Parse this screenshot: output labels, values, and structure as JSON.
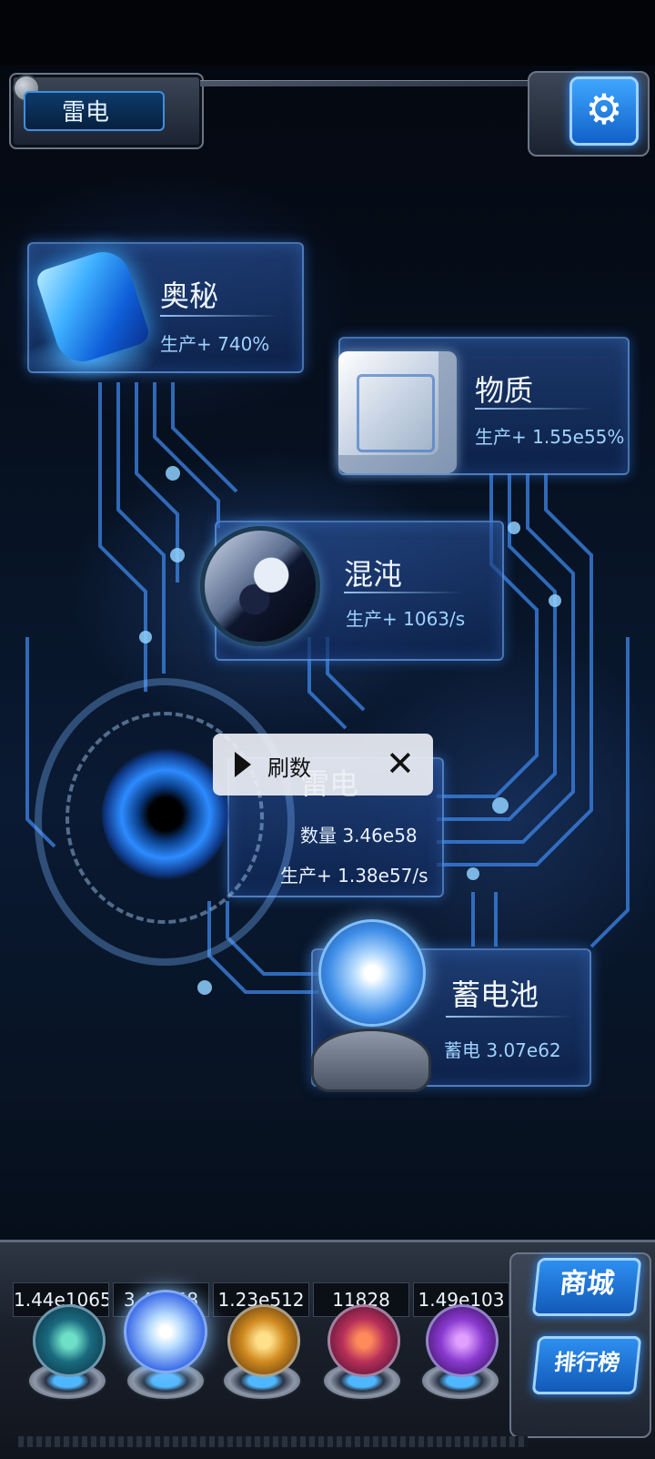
{
  "header": {
    "title": "雷电",
    "settings_icon": "gear-icon"
  },
  "nodes": {
    "arcane": {
      "name": "奥秘",
      "stat": "生产+ 740%"
    },
    "matter": {
      "name": "物质",
      "stat": "生产+ 1.55e55%"
    },
    "chaos": {
      "name": "混沌",
      "stat": "生产+ 1063/s"
    },
    "thunder": {
      "name": "雷电",
      "amount": "数量 3.46e58",
      "stat": "生产+ 1.38e57/s"
    },
    "battery": {
      "name": "蓄电池",
      "stat": "蓄电 3.07e62"
    }
  },
  "refresh_popup": {
    "label": "刷数",
    "play_icon": "play-icon",
    "close_icon": "close-icon"
  },
  "bottom": {
    "counts": [
      "1.44e1065",
      "3.46e58",
      "1.23e512",
      "11828",
      "1.49e103"
    ],
    "selected_index": 1,
    "shop_label": "商城",
    "ranking_label": "排行榜"
  },
  "colors": {
    "accent": "#3fa6ff",
    "card_border": "#78b4ff",
    "text_stat": "#9fd2ff"
  }
}
